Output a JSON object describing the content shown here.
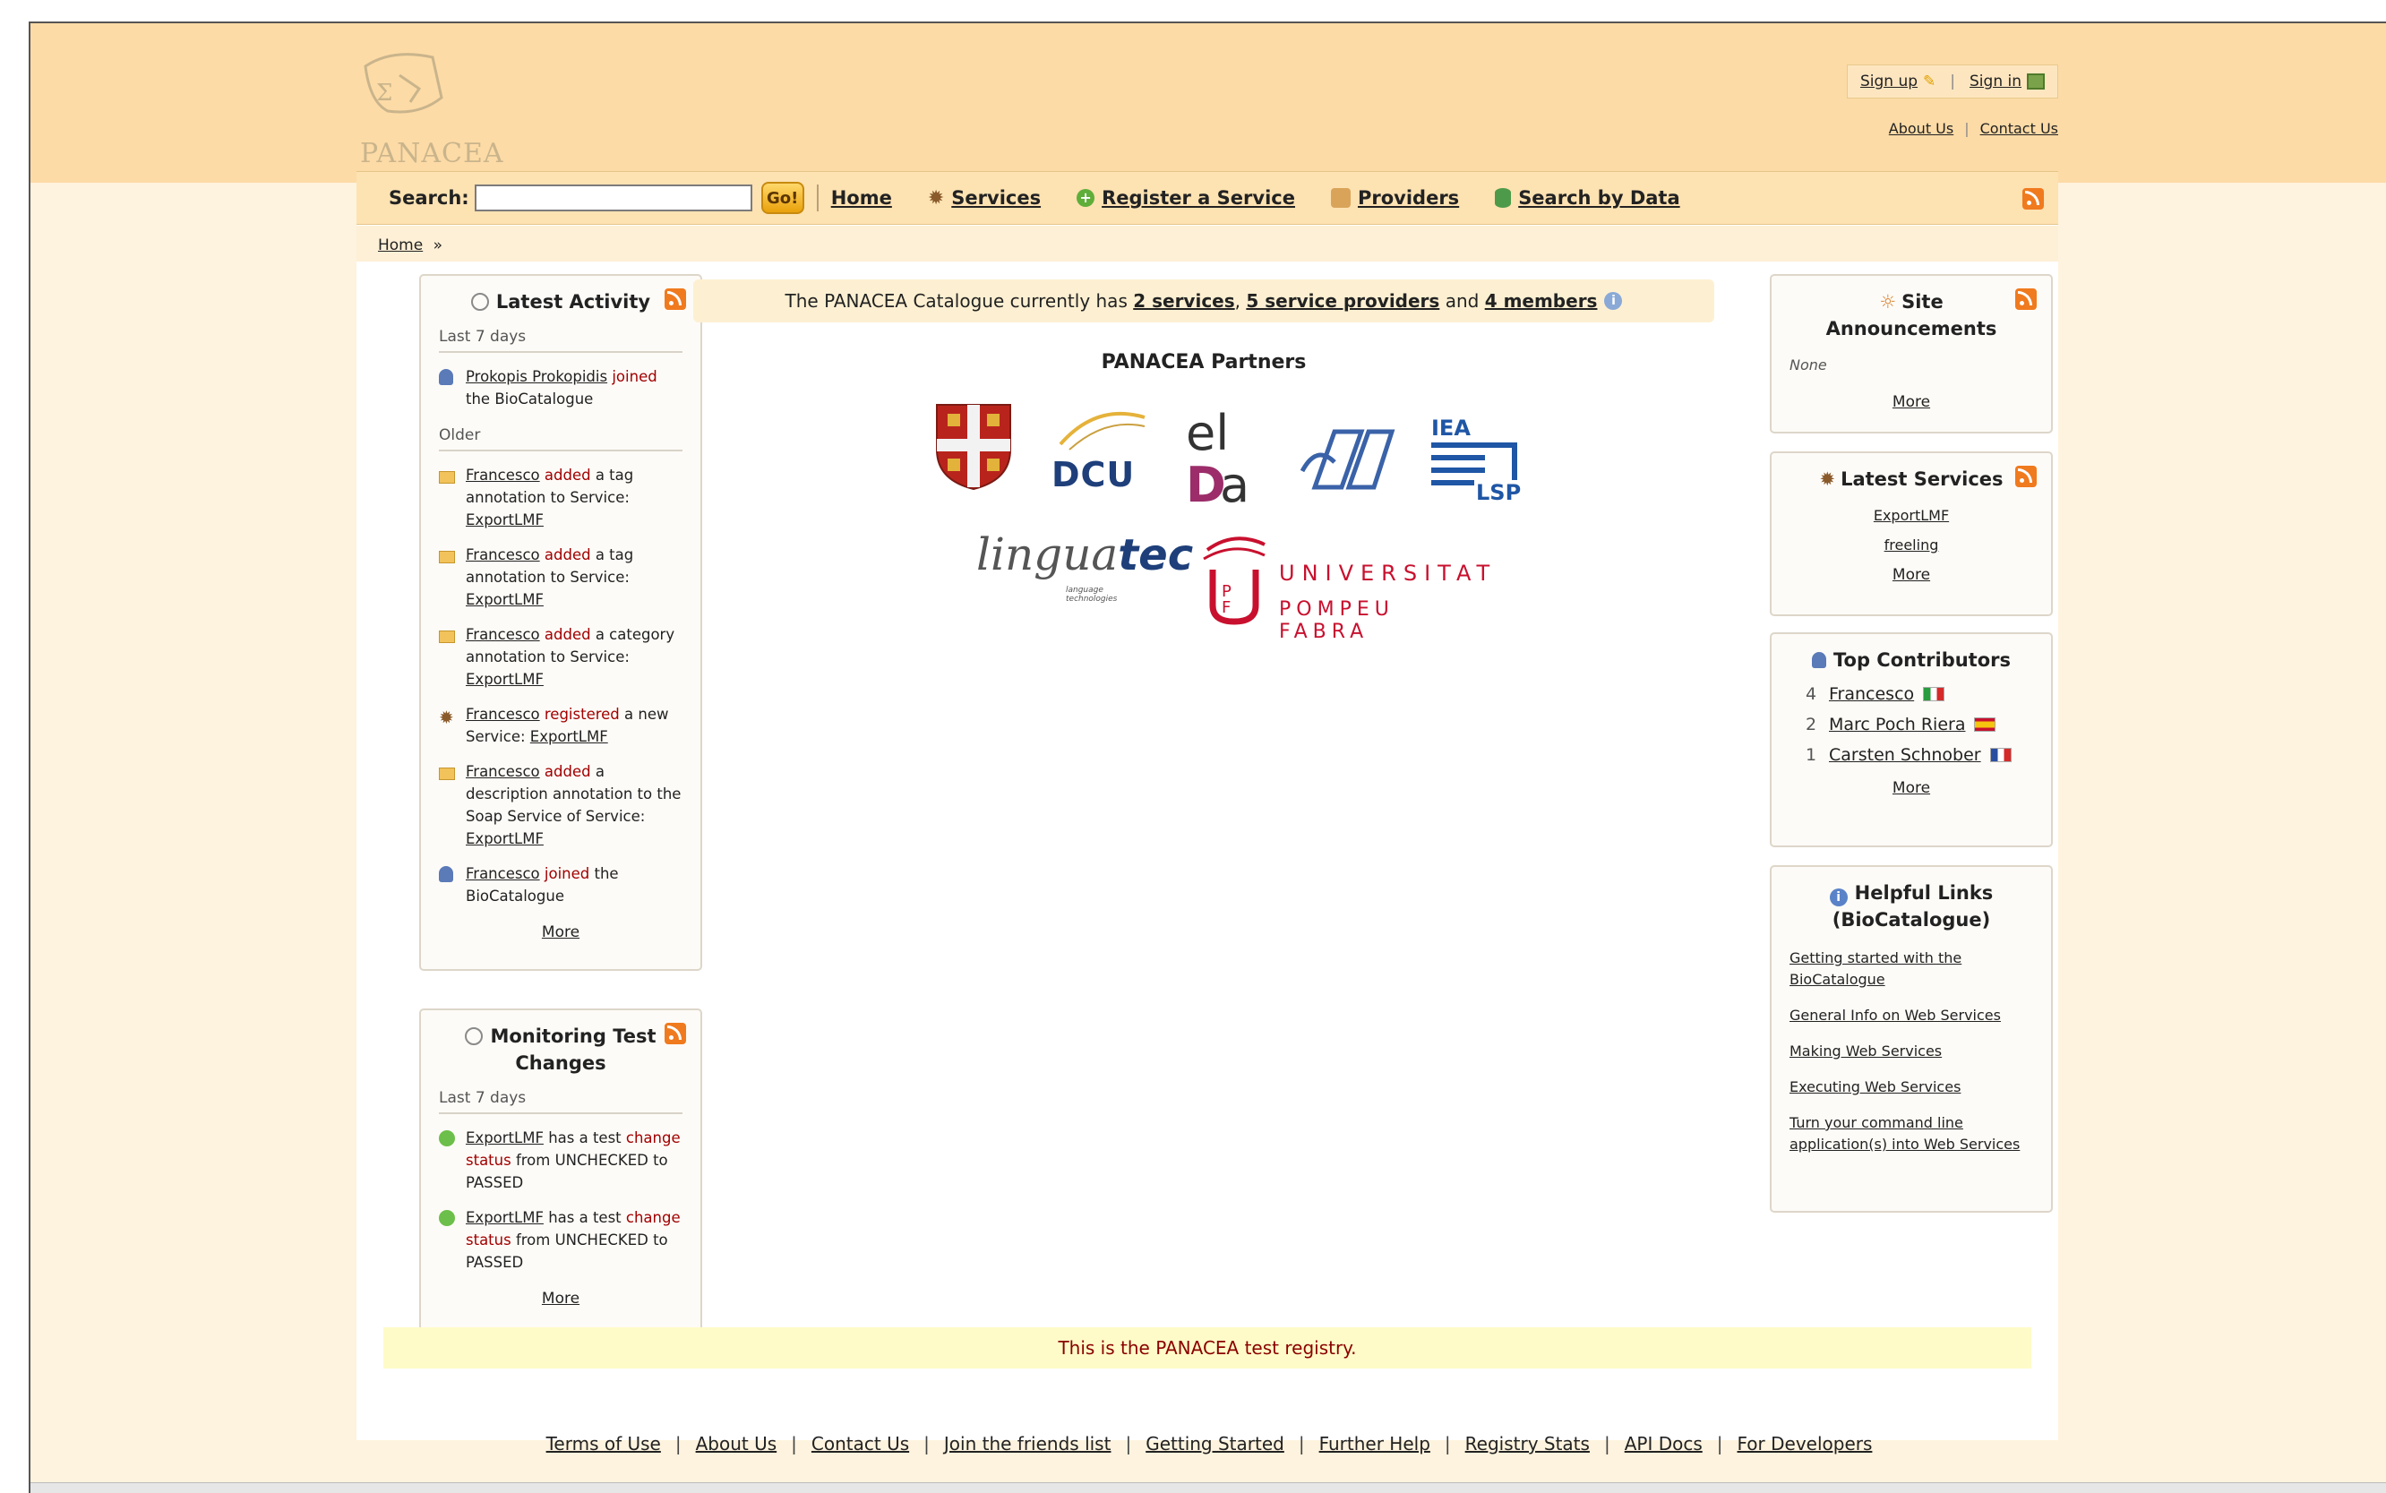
{
  "header": {
    "logo_text": "PANACEA",
    "signup": "Sign up",
    "signin": "Sign in",
    "about": "About Us",
    "contact": "Contact Us"
  },
  "nav": {
    "search_label": "Search:",
    "search_value": "",
    "go": "Go!",
    "items": [
      {
        "label": "Home",
        "icon": ""
      },
      {
        "label": "Services",
        "icon": "gear-icon"
      },
      {
        "label": "Register a Service",
        "icon": "plus-icon"
      },
      {
        "label": "Providers",
        "icon": "provider-icon"
      },
      {
        "label": "Search by Data",
        "icon": "database-icon"
      }
    ]
  },
  "breadcrumb": {
    "home": "Home",
    "sep": "»"
  },
  "latest_activity": {
    "title": "Latest Activity",
    "last7": "Last 7 days",
    "older": "Older",
    "recent": [
      {
        "user": "Prokopis Prokopidis",
        "verb": "joined",
        "rest": "the BioCatalogue"
      }
    ],
    "items": [
      {
        "user": "Francesco",
        "verb": "added",
        "rest": "a tag annotation to Service:",
        "target": "ExportLMF",
        "icon": "note-icon"
      },
      {
        "user": "Francesco",
        "verb": "added",
        "rest": "a tag annotation to Service:",
        "target": "ExportLMF",
        "icon": "note-icon"
      },
      {
        "user": "Francesco",
        "verb": "added",
        "rest": "a category annotation to Service:",
        "target": "ExportLMF",
        "icon": "note-icon"
      },
      {
        "user": "Francesco",
        "verb": "registered",
        "rest": "a new Service:",
        "target": "ExportLMF",
        "icon": "gear-icon"
      },
      {
        "user": "Francesco",
        "verb": "added",
        "rest": "a description annotation to the Soap Service of Service:",
        "target": "ExportLMF",
        "icon": "note-icon"
      },
      {
        "user": "Francesco",
        "verb": "joined",
        "rest": "the BioCatalogue",
        "target": "",
        "icon": "user-icon"
      }
    ],
    "more": "More"
  },
  "monitoring": {
    "title": "Monitoring Test Changes",
    "last7": "Last 7 days",
    "items": [
      {
        "target": "ExportLMF",
        "pre": "has a test",
        "verb": "change status",
        "rest": "from UNCHECKED to PASSED"
      },
      {
        "target": "ExportLMF",
        "pre": "has a test",
        "verb": "change status",
        "rest": "from UNCHECKED to PASSED"
      }
    ],
    "more": "More"
  },
  "stats": {
    "prefix": "The PANACEA Catalogue currently has",
    "services": "2 services",
    "comma": ",",
    "providers": "5 service providers",
    "and": "and",
    "members": "4 members"
  },
  "partners": {
    "title": "PANACEA Partners",
    "dcu": "DCU",
    "iea1": "IEA",
    "iea2": "LSP",
    "lingua": "lingua",
    "tec": "tec",
    "lingua_sub": "language technologies",
    "upf1": "UNIVERSITAT",
    "upf2": "POMPEU FABRA"
  },
  "announcements": {
    "title": "Site Announcements",
    "none": "None",
    "more": "More"
  },
  "latest_services": {
    "title": "Latest Services",
    "items": [
      "ExportLMF",
      "freeling"
    ],
    "more": "More"
  },
  "top_contributors": {
    "title": "Top Contributors",
    "items": [
      {
        "count": "4",
        "name": "Francesco",
        "flag": "it"
      },
      {
        "count": "2",
        "name": "Marc Poch Riera",
        "flag": "es"
      },
      {
        "count": "1",
        "name": "Carsten Schnober",
        "flag": "fr"
      }
    ],
    "more": "More"
  },
  "helpful": {
    "title": "Helpful Links (BioCatalogue)",
    "links": [
      "Getting started with the BioCatalogue",
      "General Info on Web Services",
      "Making Web Services",
      "Executing Web Services",
      "Turn your command line application(s) into Web Services"
    ]
  },
  "testbar": "This is the PANACEA test registry.",
  "footer": [
    "Terms of Use",
    "About Us",
    "Contact Us",
    "Join the friends list",
    "Getting Started",
    "Further Help",
    "Registry Stats",
    "API Docs",
    "For Developers"
  ],
  "colors": {
    "headband": "#fddba6",
    "nav": "#fde2b2",
    "accent_red": "#a10000",
    "rss": "#f07a1e"
  }
}
